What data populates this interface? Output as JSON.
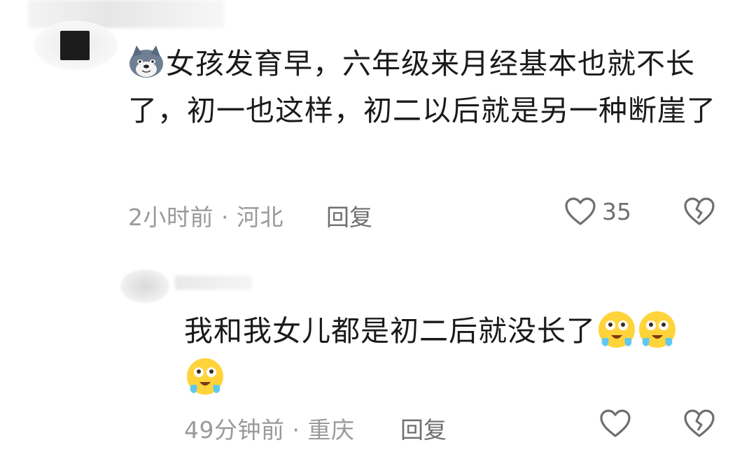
{
  "comments": [
    {
      "text": "女孩发育早，六年级来月经基本也就不长了，初一也这样，初二以后就是另一种断崖了",
      "time": "2小时前",
      "separator": "·",
      "location": "河北",
      "reply_label": "回复",
      "like_count": "35",
      "avatar_icon": "wolf-emoji-icon"
    },
    {
      "text": "我和我女儿都是初二后就没长了",
      "trailing_emoji_count": 3,
      "trailing_emoji_icon": "crying-face-emoji-icon",
      "time": "49分钟前",
      "separator": "·",
      "location": "重庆",
      "reply_label": "回复",
      "like_count": ""
    }
  ],
  "colors": {
    "text": "#1a1a1a",
    "meta": "#9a9a9a",
    "action": "#6f6f6f"
  }
}
